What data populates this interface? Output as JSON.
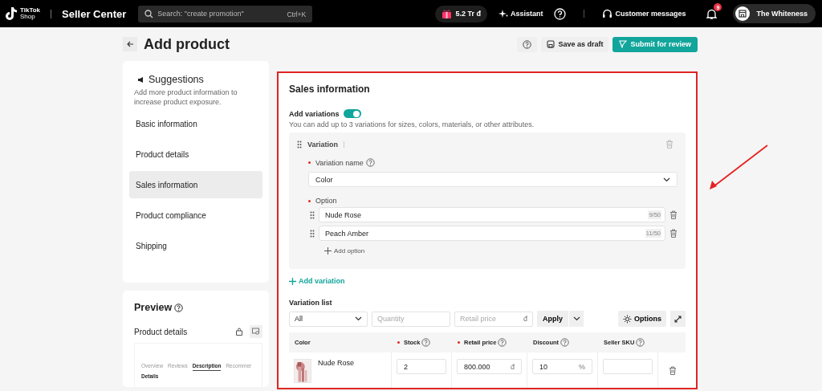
{
  "top_bar": {
    "logo_line1": "TikTok",
    "logo_line2": "Shop",
    "product": "Seller Center",
    "search": {
      "placeholder": "Search: \"create promotion\"",
      "shortcut": "Ctrl+K"
    },
    "balance": "5.2 Tr đ",
    "assistant": "Assistant",
    "messages": "Customer messages",
    "notification_count": "9",
    "account": "The Whiteness"
  },
  "header": {
    "title": "Add product",
    "buttons": [
      {
        "label": "Save as draft",
        "kind": "secondary"
      },
      {
        "label": "Submit for review",
        "kind": "primary"
      }
    ]
  },
  "sidebar": {
    "title": "Suggestions",
    "hint": "Add more product information to increase product exposure.",
    "items": [
      {
        "label": "Basic information",
        "selected": false
      },
      {
        "label": "Product details",
        "selected": false
      },
      {
        "label": "Sales information",
        "selected": true
      },
      {
        "label": "Product compliance",
        "selected": false
      },
      {
        "label": "Shipping",
        "selected": false
      }
    ]
  },
  "preview": {
    "title": "Preview",
    "subtitle": "Product details",
    "tabs": [
      {
        "label": "Overview",
        "selected": false
      },
      {
        "label": "Reviews",
        "selected": false
      },
      {
        "label": "Description",
        "selected": true
      },
      {
        "label": "Recommer",
        "selected": false
      }
    ],
    "section": "Details"
  },
  "sales": {
    "title": "Sales information",
    "variations_toggle": {
      "label": "Add variations",
      "on": true
    },
    "hint": "You can add up to 3 variations for sizes, colors, materials, or other attributes.",
    "variation": {
      "label": "Variation",
      "name_label": "Variation name",
      "name_value": "Color",
      "option_label": "Option",
      "options": [
        {
          "value": "Nude Rose",
          "count": "9/50"
        },
        {
          "value": "Peach Amber",
          "count": "11/50"
        }
      ],
      "add_option": "Add option"
    },
    "add_variation": "Add variation",
    "list_title": "Variation list",
    "filter_value": "All",
    "quantity_placeholder": "Quantity",
    "price_placeholder": "Retail price",
    "currency": "đ",
    "apply": "Apply",
    "options_button": "Options",
    "table": {
      "columns": [
        {
          "label": "Color",
          "required": false,
          "help": false
        },
        {
          "label": "Stock",
          "required": true,
          "help": true
        },
        {
          "label": "Retail price",
          "required": true,
          "help": true
        },
        {
          "label": "Discount",
          "required": false,
          "help": true
        },
        {
          "label": "Seller SKU",
          "required": false,
          "help": true
        }
      ],
      "rows": [
        {
          "variant": "Nude Rose",
          "stock": "2",
          "price": "800.000",
          "price_unit": "đ",
          "discount": "10",
          "discount_unit": "%"
        }
      ]
    }
  },
  "annotation": {
    "frame": true,
    "arrow": true
  }
}
